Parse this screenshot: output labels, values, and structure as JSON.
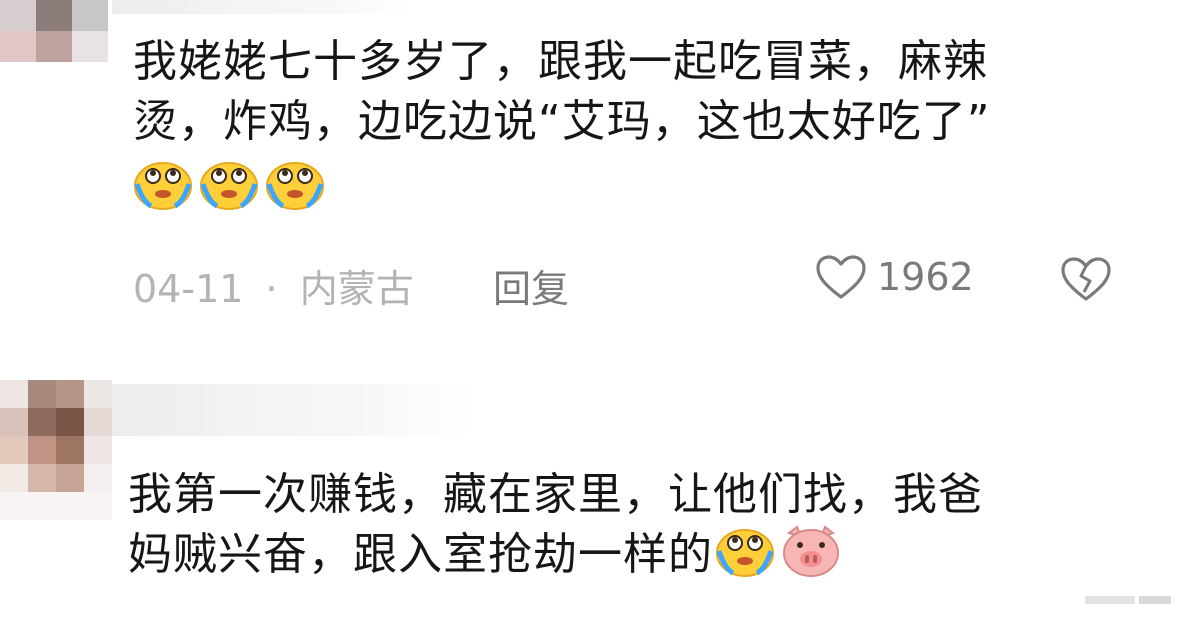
{
  "comments": [
    {
      "text_line1": "我姥姥七十多岁了，跟我一起吃冒菜，麻辣",
      "text_line2": "烫，炸鸡，边吃边说“艾玛，这也太好吃了”",
      "emojis": [
        "crying-laugh-icon",
        "crying-laugh-icon",
        "crying-laugh-icon"
      ],
      "date": "04-11",
      "separator": "·",
      "location": "内蒙古",
      "reply_label": "回复",
      "like_count": "1962"
    },
    {
      "text_line1": "我第一次赚钱，藏在家里，让他们找，我爸",
      "text_line2": "妈贼兴奋，跟入室抢劫一样的",
      "emojis": [
        "crying-laugh-icon",
        "pig-face-icon"
      ]
    }
  ],
  "colors": {
    "text": "#161616",
    "meta": "#b3b3b3",
    "action": "#7a7a7a",
    "emoji_face": "#ffcf3a",
    "pig_face": "#f7b5b5"
  }
}
